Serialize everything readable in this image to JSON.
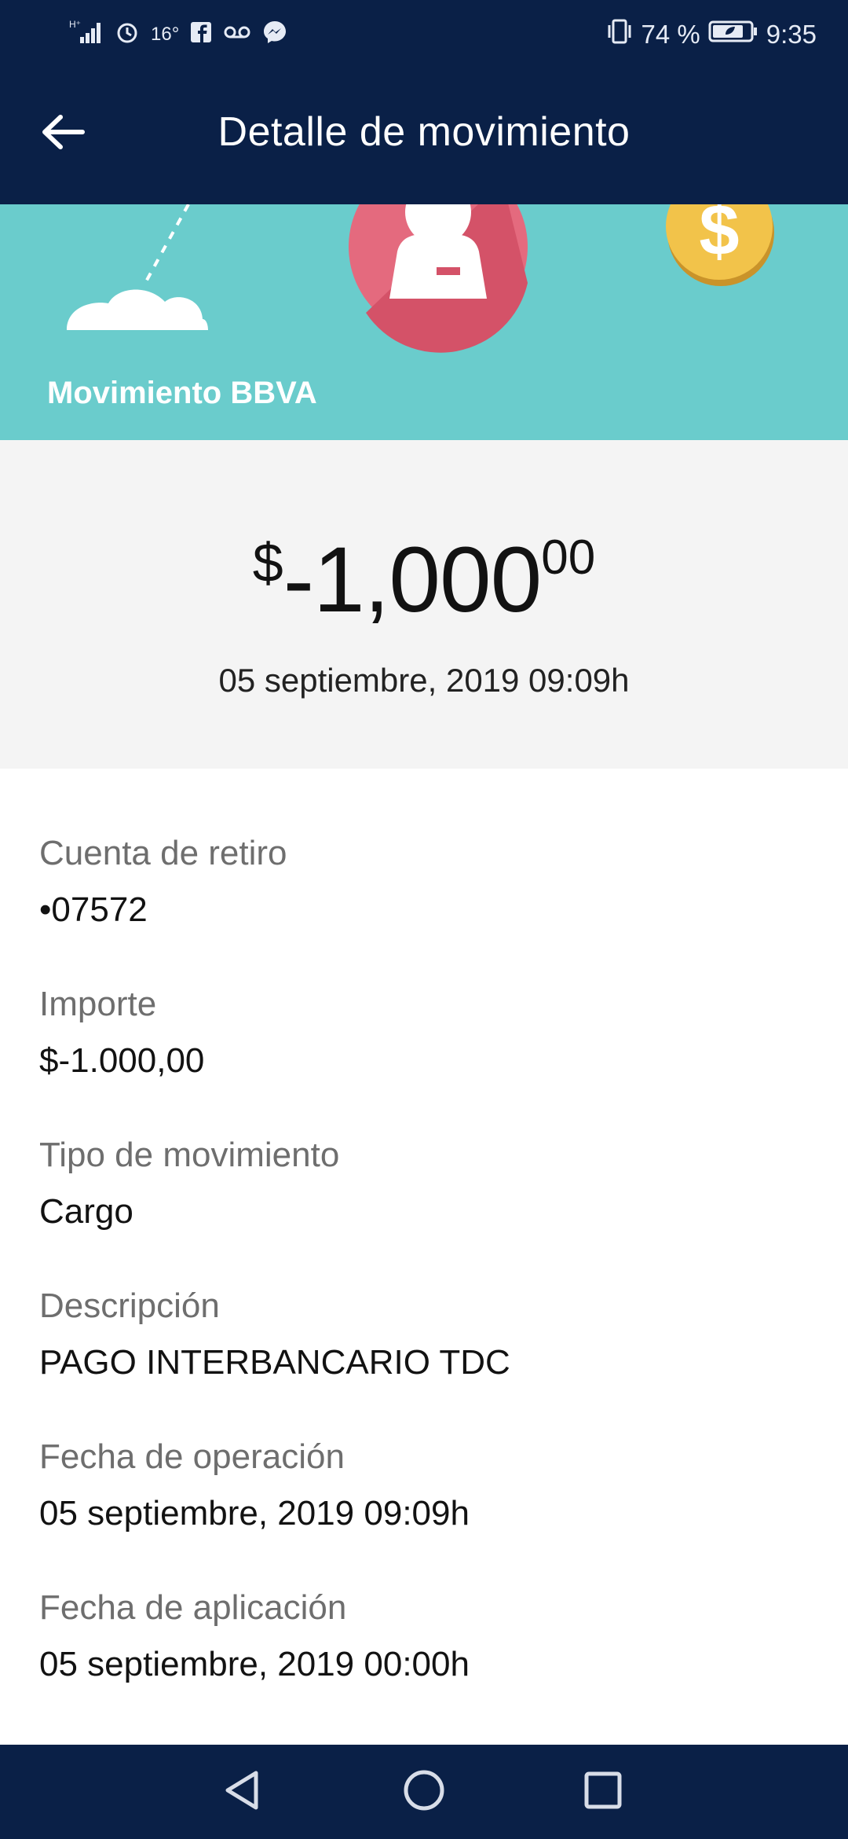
{
  "status_bar": {
    "temperature": "16°",
    "battery_percent": "74 %",
    "time": "9:35",
    "left_icons": [
      "network-signal-icon",
      "alarm-icon",
      "facebook-icon",
      "voicemail-icon",
      "messenger-icon"
    ],
    "right_icons": [
      "vibrate-icon",
      "battery-icon"
    ]
  },
  "header": {
    "title": "Detalle de movimiento",
    "back_icon": "arrow-left-icon"
  },
  "banner": {
    "label": "Movimiento BBVA",
    "background_color": "#6acccc"
  },
  "summary": {
    "currency": "$",
    "amount": "-1,000",
    "decimals": "00",
    "date": "05 septiembre, 2019 09:09h"
  },
  "details": [
    {
      "label": "Cuenta de retiro",
      "value": "•07572"
    },
    {
      "label": "Importe",
      "value": "$-1.000,00"
    },
    {
      "label": "Tipo de movimiento",
      "value": "Cargo"
    },
    {
      "label": "Descripción",
      "value": "PAGO INTERBANCARIO TDC"
    },
    {
      "label": "Fecha de operación",
      "value": "05 septiembre, 2019 09:09h"
    },
    {
      "label": "Fecha de aplicación",
      "value": "05 septiembre, 2019 00:00h"
    }
  ],
  "nav_bar": {
    "icons": [
      "back-triangle-icon",
      "home-circle-icon",
      "recents-square-icon"
    ]
  },
  "colors": {
    "primary_dark": "#0a2047",
    "banner_teal": "#6acccc",
    "summary_bg": "#f4f4f4"
  }
}
